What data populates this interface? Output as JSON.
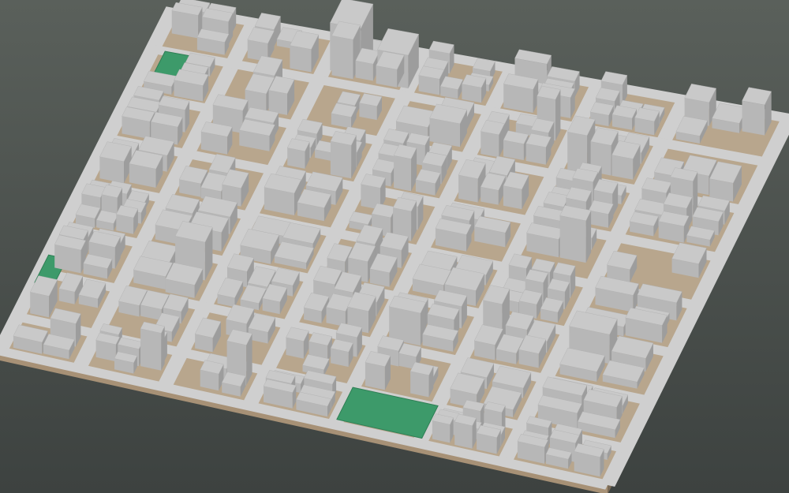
{
  "scene": {
    "type": "3d-city-block-model",
    "view": "isometric-oblique",
    "labels_visible": false
  },
  "colors": {
    "background_top": "#5a605b",
    "background_bottom": "#3d4240",
    "terrain_ground": "#b8a68d",
    "terrain_ground_light": "#c8b69c",
    "base_side_front": "#a79176",
    "base_side_right": "#7a6a56",
    "street": "#cfcfcf",
    "building_top": "#c9c9c9",
    "building_side_light": "#b7b7b7",
    "building_side_dark": "#9d9d9d",
    "park": "#3d9a6a",
    "park_edge": "#2f7f55"
  },
  "features": {
    "parks_count": 3
  }
}
